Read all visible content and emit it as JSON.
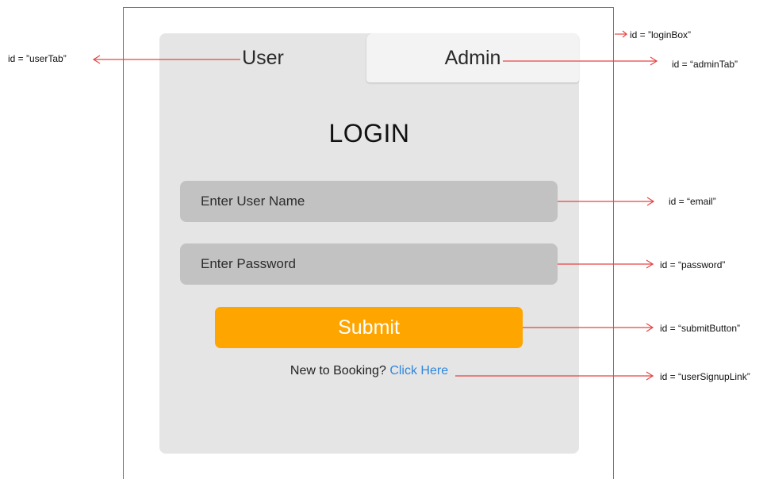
{
  "tabs": {
    "user": "User",
    "admin": "Admin"
  },
  "login": {
    "heading": "LOGIN",
    "username_placeholder": "Enter User Name",
    "password_placeholder": "Enter Password",
    "submit_label": "Submit",
    "signup_prompt": "New to Booking?",
    "signup_link": "Click Here"
  },
  "annotations": {
    "login_box": "id = ”loginBox”",
    "user_tab": "id = ”userTab”",
    "admin_tab": "id = “adminTab”",
    "email": "id = “email”",
    "password": "id = “password”",
    "submit_button": "id = “submitButton”",
    "user_signup_link": "id = “userSignupLink”"
  },
  "colors": {
    "annotation_line": "#e64545",
    "submit_bg": "#ffa500",
    "link": "#2e86de",
    "card_bg": "#e5e5e5",
    "input_bg": "#c2c2c2"
  }
}
